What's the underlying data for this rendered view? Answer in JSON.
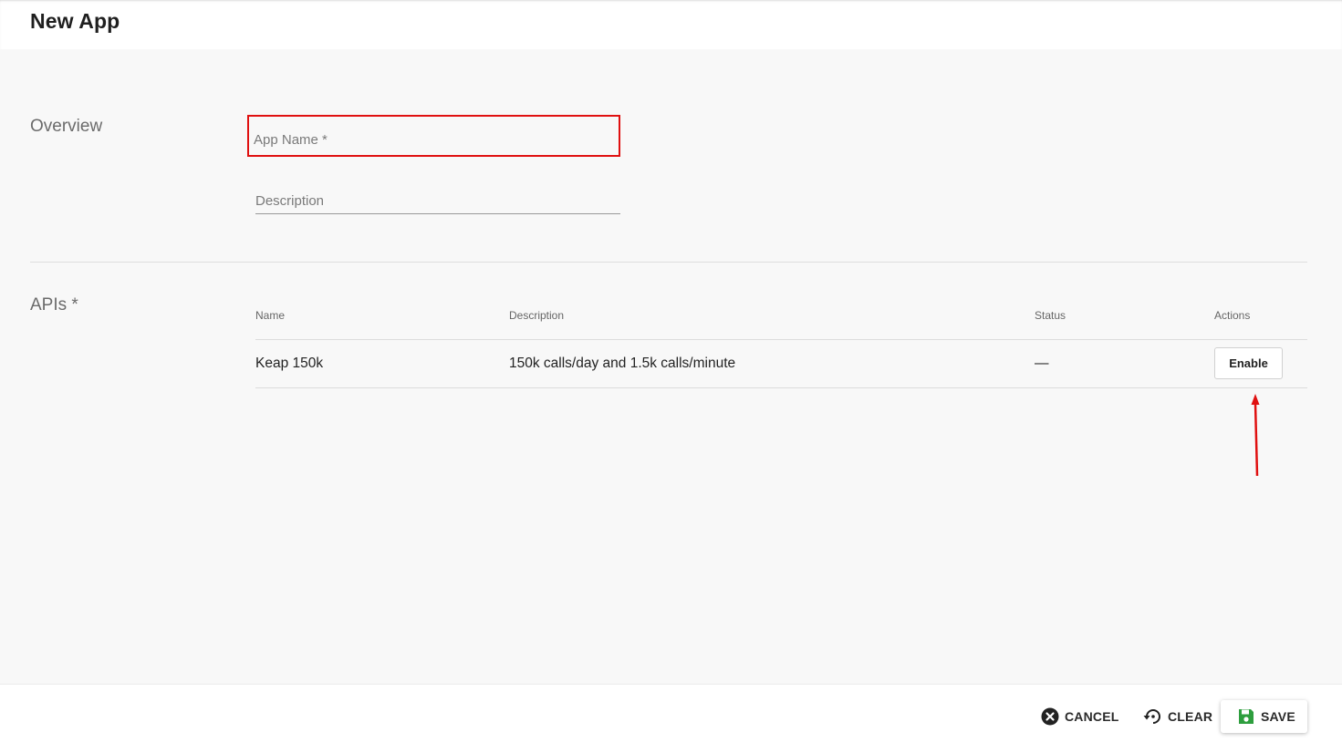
{
  "header": {
    "title": "New App"
  },
  "overview": {
    "title": "Overview",
    "app_name": {
      "placeholder": "App Name *",
      "value": ""
    },
    "description": {
      "placeholder": "Description",
      "value": ""
    }
  },
  "apis": {
    "title": "APIs *",
    "columns": [
      "Name",
      "Description",
      "Status",
      "Actions"
    ],
    "rows": [
      {
        "name": "Keap 150k",
        "description": "150k calls/day and 1.5k calls/minute",
        "status": "—",
        "action_label": "Enable"
      }
    ]
  },
  "footer": {
    "cancel_label": "CANCEL",
    "clear_label": "CLEAR",
    "save_label": "SAVE"
  },
  "icons": {
    "cancel": "close-circle-icon",
    "clear": "restore-icon",
    "save": "floppy-disk-icon"
  },
  "colors": {
    "highlight": "#e01010",
    "save_icon": "#2e9e3e",
    "background": "#f8f8f8"
  }
}
